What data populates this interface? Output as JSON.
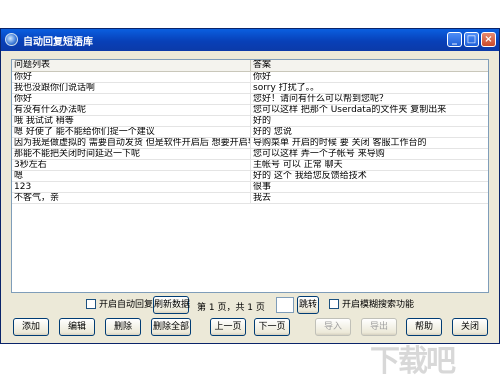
{
  "window": {
    "title": "自动回复短语库",
    "minimize_glyph": "_",
    "maximize_glyph": "□",
    "close_glyph": "×"
  },
  "table": {
    "columns": [
      "问题列表",
      "答案"
    ],
    "rows": [
      [
        "你好",
        "你好"
      ],
      [
        "我也没跟你们说话啊",
        "sorry 打扰了。。"
      ],
      [
        "你好",
        "您好！请问有什么可以帮到您呢？"
      ],
      [
        "有没有什么办法呢",
        "您可以这样 把那个 Userdata的文件夹  复制出来"
      ],
      [
        "哦 我试试 稍等",
        "好的"
      ],
      [
        "嗯 好使了 能不能给你们提一个建议",
        "好的 您说"
      ],
      [
        "因为我是做虚拟的 需要自动发货 但是软件开启后 想要开启导购菜单就不能",
        "导购菜单   开启的时候 要    关闭  客服工作台的"
      ],
      [
        "那能不能把关闭时间延迟一下呢",
        "您可以这样      弄一个子帐号 来导购"
      ],
      [
        "3秒左右",
        "主帐号  可以     正常 聊天"
      ],
      [
        "嗯",
        "好的 这个 我给您反馈给技术"
      ],
      [
        "123",
        "很事"
      ],
      [
        "不客气，亲",
        "我去"
      ]
    ]
  },
  "controls": {
    "auto_reply_label": "开启自动回复",
    "refresh_label": "刷新数据",
    "page_info": "第 1 页，共 1 页",
    "jump_label": "跳转",
    "fuzzy_search_label": "开启模糊搜索功能"
  },
  "buttons": {
    "add": "添加",
    "edit": "编辑",
    "delete": "删除",
    "delete_all": "删除全部",
    "prev": "上一页",
    "next": "下一页",
    "import": "导入",
    "export": "导出",
    "help": "帮助",
    "close": "关闭"
  },
  "watermark": "下载吧"
}
